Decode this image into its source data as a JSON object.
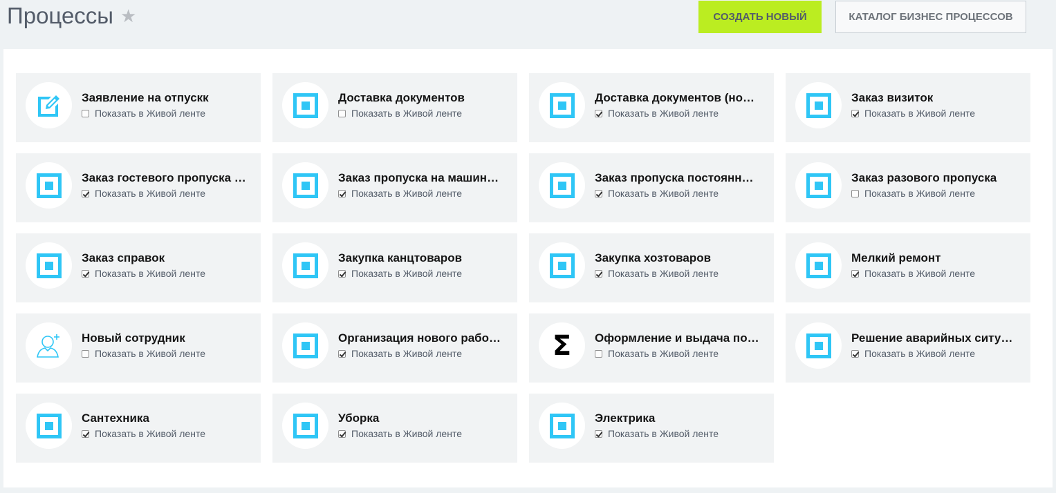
{
  "header": {
    "title": "Процессы",
    "create_button": "СОЗДАТЬ НОВЫЙ",
    "catalog_button": "КАТАЛОГ БИЗНЕС ПРОЦЕССОВ"
  },
  "colors": {
    "accent_green": "#bbed21",
    "icon_blue": "#2fc6f6",
    "card_bg": "#f1f3f4"
  },
  "cards": [
    {
      "title": "Заявление на отпускк",
      "option_label": "Показать в Живой ленте",
      "checked": false,
      "icon": "edit-icon"
    },
    {
      "title": "Доставка документов",
      "option_label": "Показать в Живой ленте",
      "checked": false,
      "icon": "square-icon"
    },
    {
      "title": "Доставка документов (но…",
      "option_label": "Показать в Живой ленте",
      "checked": true,
      "icon": "square-icon"
    },
    {
      "title": "Заказ визиток",
      "option_label": "Показать в Живой ленте",
      "checked": true,
      "icon": "square-icon"
    },
    {
      "title": "Заказ гостевого пропуска …",
      "option_label": "Показать в Живой ленте",
      "checked": true,
      "icon": "square-icon"
    },
    {
      "title": "Заказ пропуска на машин…",
      "option_label": "Показать в Живой ленте",
      "checked": true,
      "icon": "square-icon"
    },
    {
      "title": "Заказ пропуска постоянн…",
      "option_label": "Показать в Живой ленте",
      "checked": true,
      "icon": "square-icon"
    },
    {
      "title": "Заказ разового пропуска",
      "option_label": "Показать в Живой ленте",
      "checked": false,
      "icon": "square-icon"
    },
    {
      "title": "Заказ справок",
      "option_label": "Показать в Живой ленте",
      "checked": true,
      "icon": "square-icon"
    },
    {
      "title": "Закупка канцтоваров",
      "option_label": "Показать в Живой ленте",
      "checked": true,
      "icon": "square-icon"
    },
    {
      "title": "Закупка хозтоваров",
      "option_label": "Показать в Живой ленте",
      "checked": true,
      "icon": "square-icon"
    },
    {
      "title": "Мелкий ремонт",
      "option_label": "Показать в Живой ленте",
      "checked": true,
      "icon": "square-icon"
    },
    {
      "title": "Новый сотрудник",
      "option_label": "Показать в Живой ленте",
      "checked": false,
      "icon": "add-user-icon"
    },
    {
      "title": "Организация нового рабо…",
      "option_label": "Показать в Живой ленте",
      "checked": true,
      "icon": "square-icon"
    },
    {
      "title": "Оформление и выдача по…",
      "option_label": "Показать в Живой ленте",
      "checked": false,
      "icon": "sigma-icon"
    },
    {
      "title": "Решение аварийных ситу…",
      "option_label": "Показать в Живой ленте",
      "checked": true,
      "icon": "square-icon"
    },
    {
      "title": "Сантехника",
      "option_label": "Показать в Живой ленте",
      "checked": true,
      "icon": "square-icon"
    },
    {
      "title": "Уборка",
      "option_label": "Показать в Живой ленте",
      "checked": true,
      "icon": "square-icon"
    },
    {
      "title": "Электрика",
      "option_label": "Показать в Живой ленте",
      "checked": true,
      "icon": "square-icon"
    }
  ]
}
